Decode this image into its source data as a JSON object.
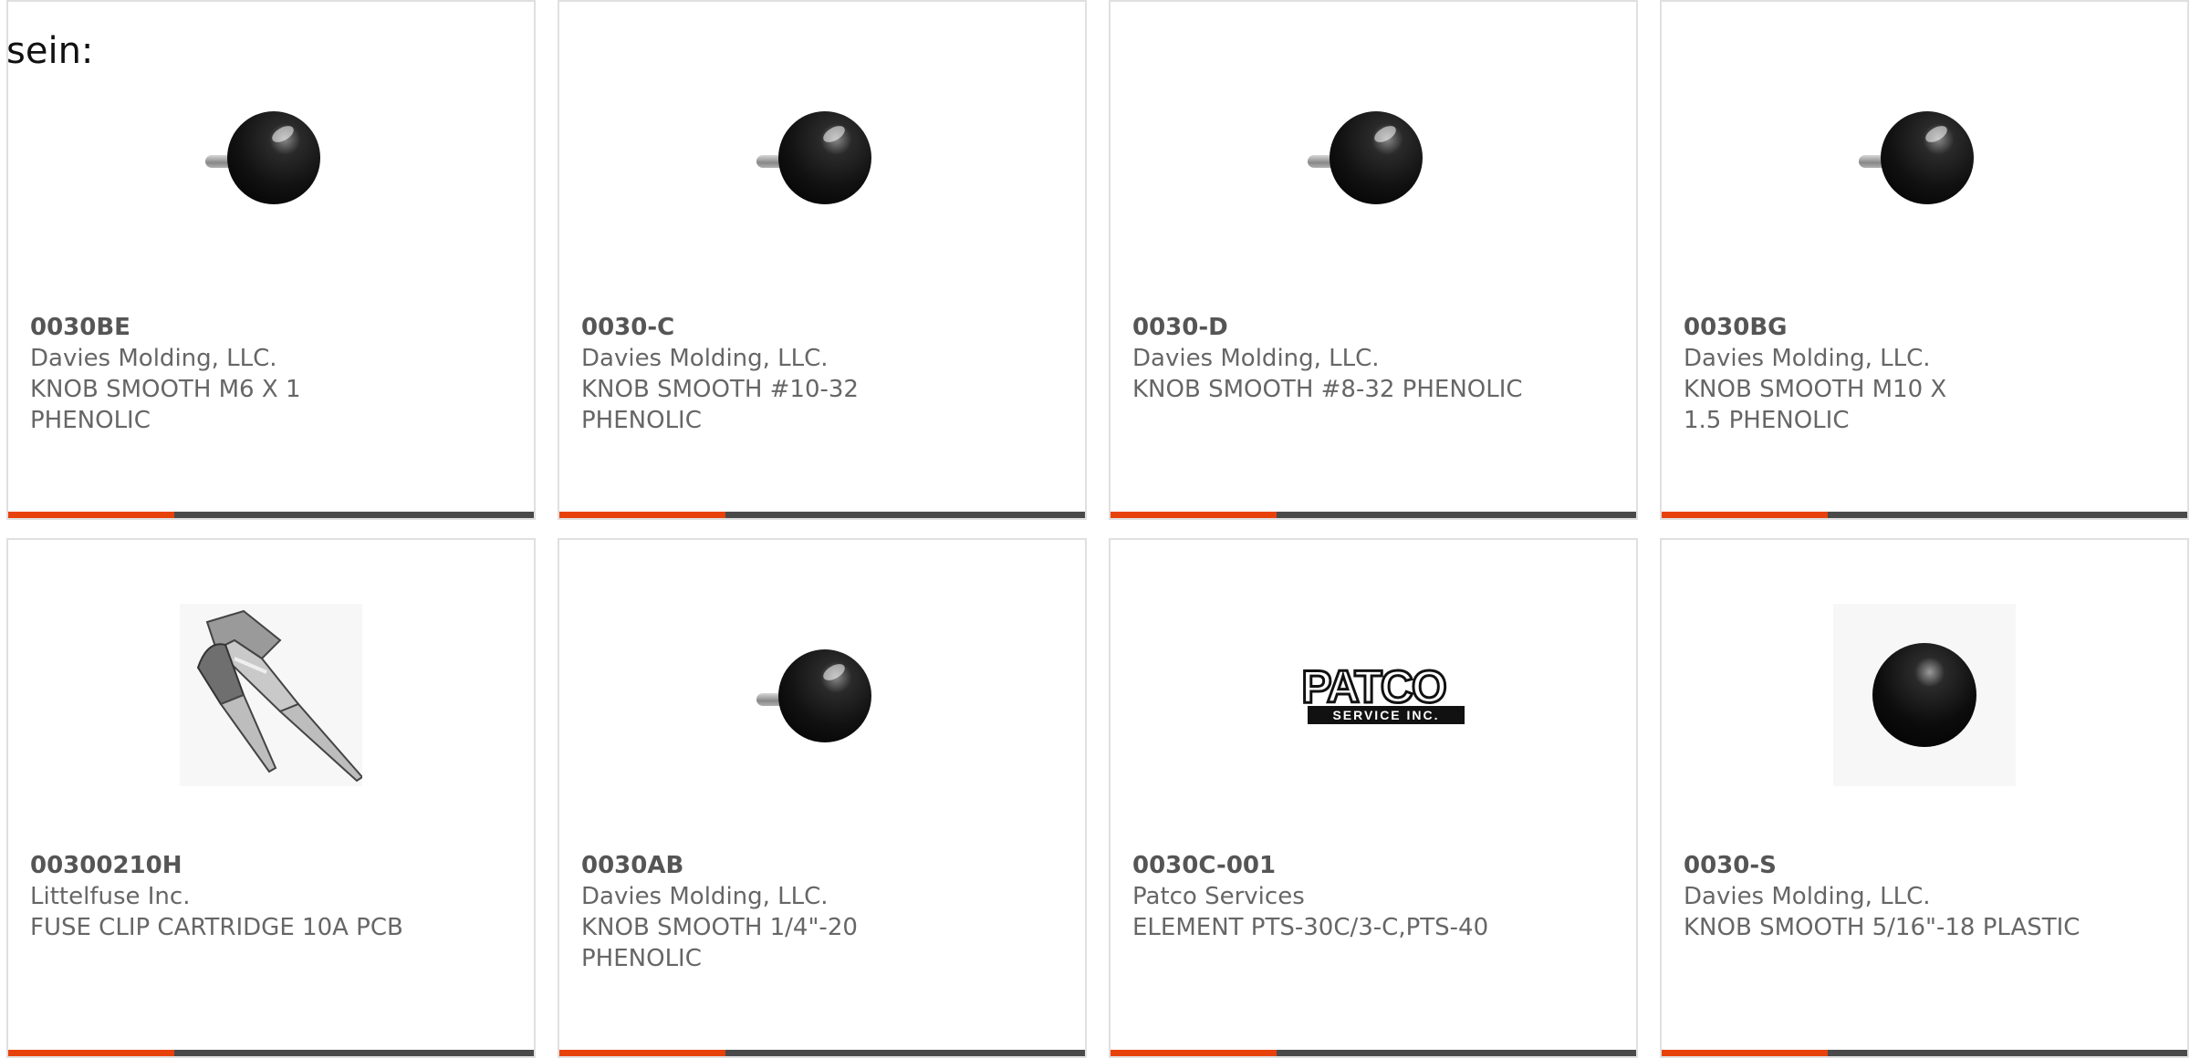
{
  "intro_text": "sein:",
  "colors": {
    "accent": "#e8420c",
    "bar": "#4a4a4a",
    "card_border": "#e0e0e0",
    "text": "#666666"
  },
  "products": [
    {
      "part_number": "0030BE",
      "manufacturer": "Davies Molding, LLC.",
      "description": "KNOB SMOOTH M6 X 1 PHENOLIC",
      "image_icon": "knob-icon"
    },
    {
      "part_number": "0030-C",
      "manufacturer": "Davies Molding, LLC.",
      "description": "KNOB SMOOTH #10-32 PHENOLIC",
      "image_icon": "knob-icon"
    },
    {
      "part_number": "0030-D",
      "manufacturer": "Davies Molding, LLC.",
      "description": "KNOB SMOOTH #8-32 PHENOLIC",
      "image_icon": "knob-icon"
    },
    {
      "part_number": "0030BG",
      "manufacturer": "Davies Molding, LLC.",
      "description": "KNOB SMOOTH M10 X 1.5 PHENOLIC",
      "image_icon": "knob-icon"
    },
    {
      "part_number": "00300210H",
      "manufacturer": "Littelfuse Inc.",
      "description": "FUSE CLIP CARTRIDGE 10A PCB",
      "image_icon": "fuse-clip-icon"
    },
    {
      "part_number": "0030AB",
      "manufacturer": "Davies Molding, LLC.",
      "description": "KNOB SMOOTH 1/4\"-20 PHENOLIC",
      "image_icon": "knob-icon"
    },
    {
      "part_number": "0030C-001",
      "manufacturer": "Patco Services",
      "description": "ELEMENT PTS-30C/3-C,PTS-40",
      "image_icon": "patco-logo",
      "logo_text": "PATCO",
      "logo_subtext": "SERVICE INC."
    },
    {
      "part_number": "0030-S",
      "manufacturer": "Davies Molding, LLC.",
      "description": "KNOB SMOOTH 5/16\"-18 PLASTIC",
      "image_icon": "ball-knob-icon"
    }
  ]
}
